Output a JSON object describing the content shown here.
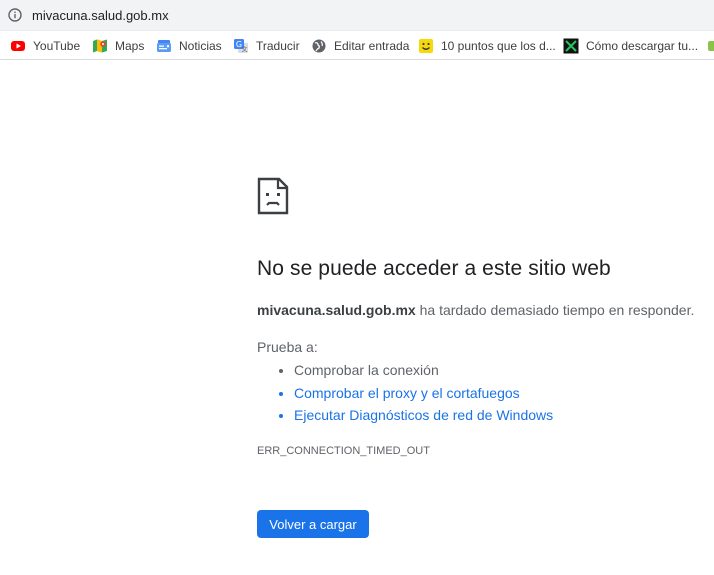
{
  "omnibox": {
    "url": "mivacuna.salud.gob.mx"
  },
  "bookmarks": [
    {
      "label": "YouTube",
      "icon": "youtube-icon"
    },
    {
      "label": "Maps",
      "icon": "maps-icon"
    },
    {
      "label": "Noticias",
      "icon": "news-icon"
    },
    {
      "label": "Traducir",
      "icon": "translate-icon"
    },
    {
      "label": "Editar entrada",
      "icon": "globe-icon"
    },
    {
      "label": "10 puntos que los d...",
      "icon": "smiley-icon"
    },
    {
      "label": "Cómo descargar tu...",
      "icon": "hacker-icon"
    }
  ],
  "error_page": {
    "heading": "No se puede acceder a este sitio web",
    "host": "mivacuna.salud.gob.mx",
    "message": " ha tardado demasiado tiempo en responder.",
    "try_label": "Prueba a:",
    "suggestions": [
      "Comprobar la conexión",
      "Comprobar el proxy y el cortafuegos",
      "Ejecutar Diagnósticos de red de Windows"
    ],
    "error_code": "ERR_CONNECTION_TIMED_OUT",
    "reload_label": "Volver a cargar"
  },
  "colors": {
    "link": "#1a73e8",
    "button": "#1a73e8",
    "text": "#202124",
    "secondary": "#5f6368"
  }
}
